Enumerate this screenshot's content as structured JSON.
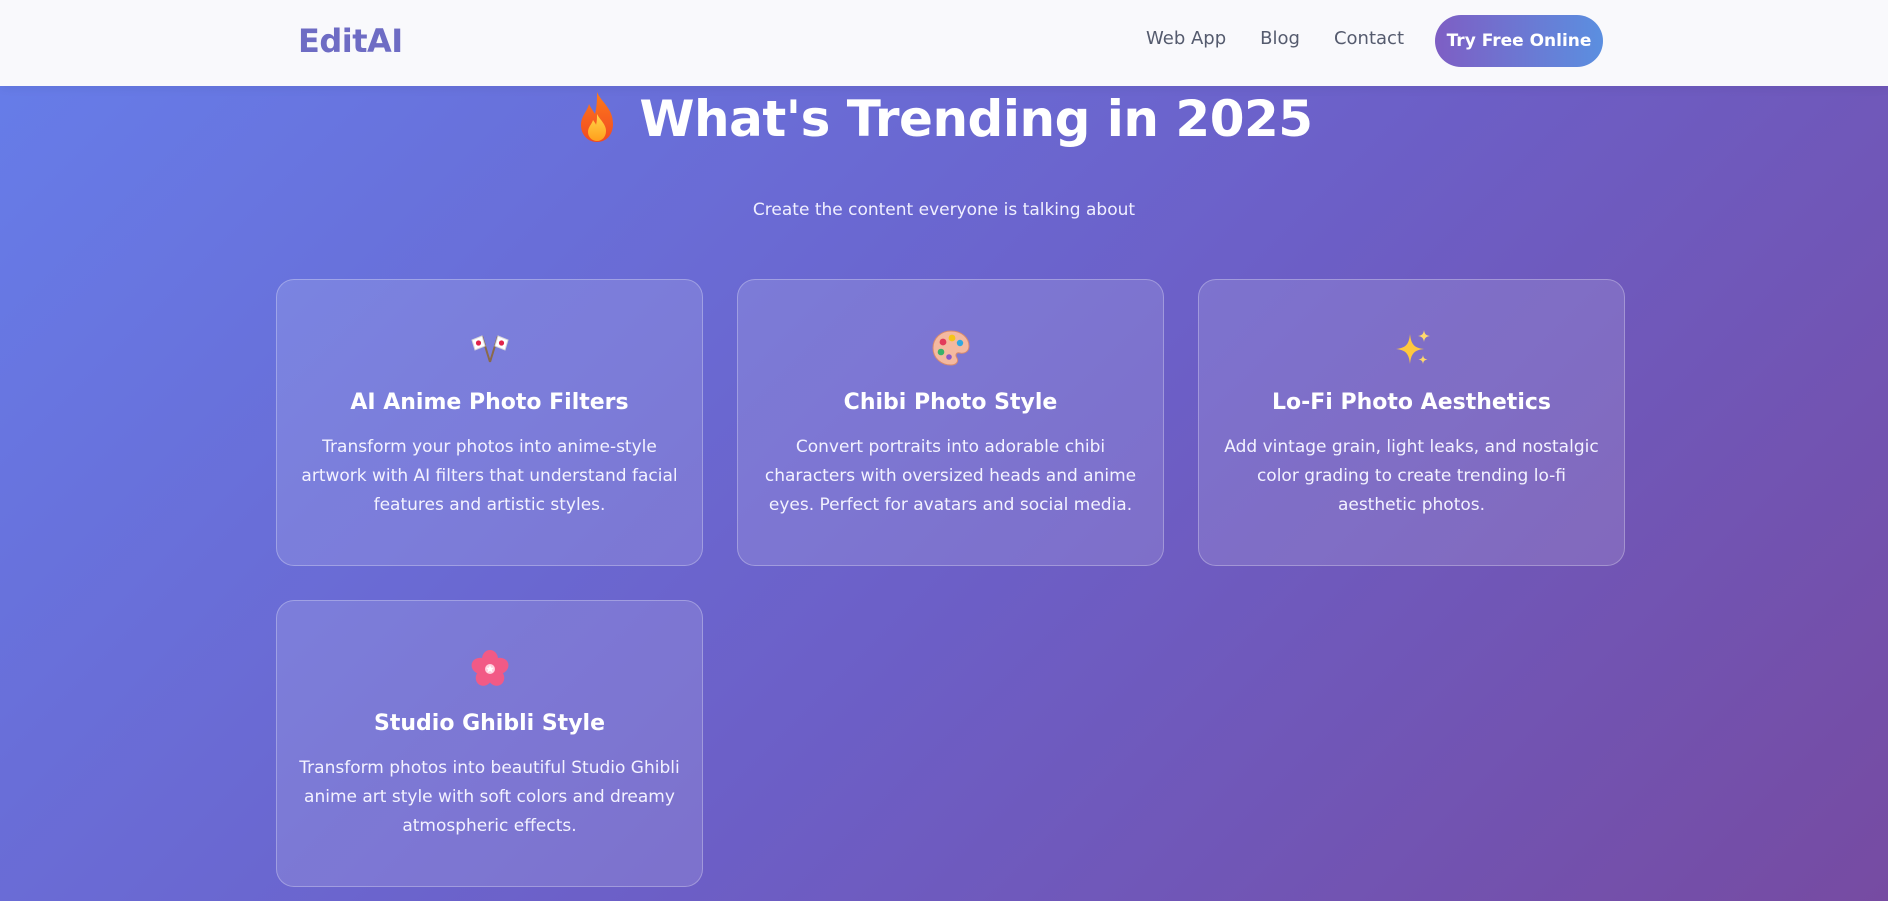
{
  "header": {
    "brand": "EditAI",
    "nav": [
      "Web App",
      "Blog",
      "Contact"
    ],
    "cta_label": "Try Free Online"
  },
  "hero": {
    "title": "What's Trending in 2025",
    "subtitle": "Create the content everyone is talking about",
    "icon": "flame-icon"
  },
  "cards": [
    {
      "icon": "crossed-flags-icon",
      "title": "AI Anime Photo Filters",
      "description": "Transform your photos into anime-style artwork with AI filters that understand facial features and artistic styles."
    },
    {
      "icon": "palette-icon",
      "title": "Chibi Photo Style",
      "description": "Convert portraits into adorable chibi characters with oversized heads and anime eyes. Perfect for avatars and social media."
    },
    {
      "icon": "sparkles-icon",
      "title": "Lo-Fi Photo Aesthetics",
      "description": "Add vintage grain, light leaks, and nostalgic color grading to create trending lo-fi aesthetic photos."
    },
    {
      "icon": "cherry-blossom-icon",
      "title": "Studio Ghibli Style",
      "description": "Transform photos into beautiful Studio Ghibli anime art style with soft colors and dreamy atmospheric effects."
    }
  ],
  "colors": {
    "brand": "#6e6cc4",
    "gradient_start": "#667eea",
    "gradient_end": "#764ba2",
    "cta_start": "#7e5ec4",
    "cta_end": "#5b8fe0"
  }
}
